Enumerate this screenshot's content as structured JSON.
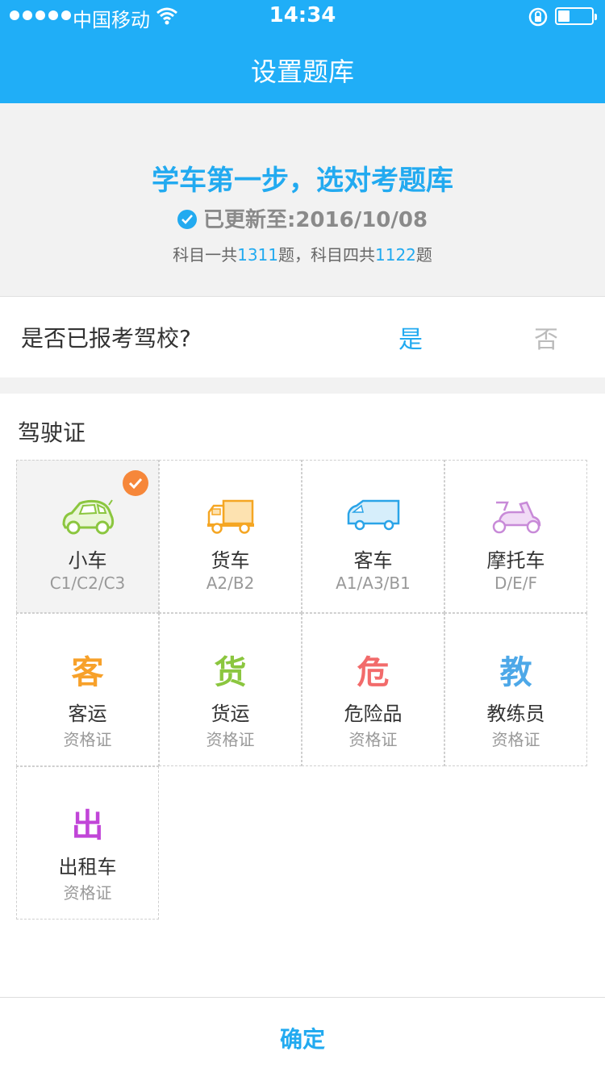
{
  "status_bar": {
    "carrier": "中国移动",
    "time": "14:34",
    "icons": [
      "signal-dots-icon",
      "wifi-icon",
      "rotation-lock-icon",
      "battery-icon"
    ]
  },
  "nav": {
    "title": "设置题库"
  },
  "hero": {
    "title": "学车第一步，选对考题库",
    "updated": "已更新至:2016/10/08",
    "count_prefix": "科目一共",
    "count_one": "1311",
    "count_mid": "题，科目四共",
    "count_four": "1122",
    "count_suffix": "题"
  },
  "question": {
    "text": "是否已报考驾校?",
    "yes": "是",
    "no": "否"
  },
  "section": {
    "title": "驾驶证"
  },
  "licenses": [
    {
      "name": "小车",
      "sub": "C1/C2/C3",
      "icon": "car-icon",
      "color": "#8bc63f",
      "selected": true
    },
    {
      "name": "货车",
      "sub": "A2/B2",
      "icon": "truck-icon",
      "color": "#f5a623"
    },
    {
      "name": "客车",
      "sub": "A1/A3/B1",
      "icon": "bus-icon",
      "color": "#2aa4e8"
    },
    {
      "name": "摩托车",
      "sub": "D/E/F",
      "icon": "scooter-icon",
      "color": "#c88ad8"
    },
    {
      "name": "客运",
      "sub": "资格证",
      "glyph": "客",
      "color": "#f7a12a"
    },
    {
      "name": "货运",
      "sub": "资格证",
      "glyph": "货",
      "color": "#8bc63f"
    },
    {
      "name": "危险品",
      "sub": "资格证",
      "glyph": "危",
      "color": "#f26b6b"
    },
    {
      "name": "教练员",
      "sub": "资格证",
      "glyph": "教",
      "color": "#4da8e8"
    },
    {
      "name": "出租车",
      "sub": "资格证",
      "glyph": "出",
      "color": "#c145d8"
    }
  ],
  "bottom": {
    "confirm": "确定"
  }
}
